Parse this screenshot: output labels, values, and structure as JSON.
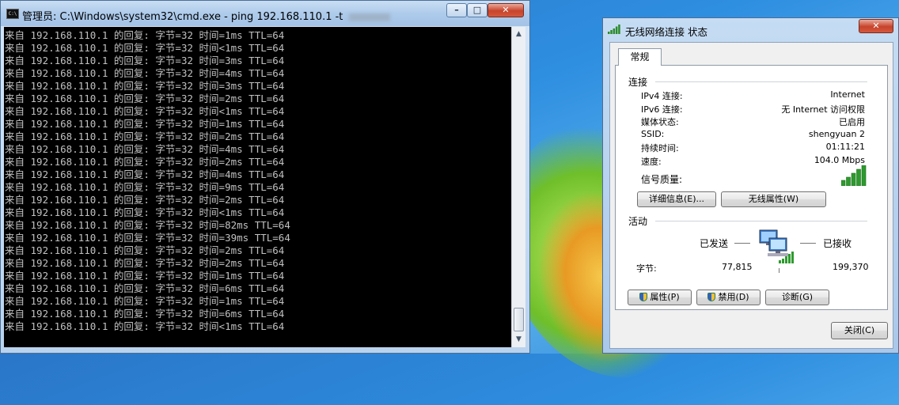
{
  "cmd": {
    "title": "管理员: C:\\Windows\\system32\\cmd.exe - ping  192.168.110.1 -t",
    "icon_text": "C:\\",
    "buttons": {
      "minimize": "–",
      "maximize": "□",
      "close": "✕"
    },
    "lines": [
      "来自 192.168.110.1 的回复: 字节=32 时间=1ms TTL=64",
      "来自 192.168.110.1 的回复: 字节=32 时间<1ms TTL=64",
      "来自 192.168.110.1 的回复: 字节=32 时间=3ms TTL=64",
      "来自 192.168.110.1 的回复: 字节=32 时间=4ms TTL=64",
      "来自 192.168.110.1 的回复: 字节=32 时间=3ms TTL=64",
      "来自 192.168.110.1 的回复: 字节=32 时间=2ms TTL=64",
      "来自 192.168.110.1 的回复: 字节=32 时间<1ms TTL=64",
      "来自 192.168.110.1 的回复: 字节=32 时间=1ms TTL=64",
      "来自 192.168.110.1 的回复: 字节=32 时间=2ms TTL=64",
      "来自 192.168.110.1 的回复: 字节=32 时间=4ms TTL=64",
      "来自 192.168.110.1 的回复: 字节=32 时间=2ms TTL=64",
      "来自 192.168.110.1 的回复: 字节=32 时间=4ms TTL=64",
      "来自 192.168.110.1 的回复: 字节=32 时间=9ms TTL=64",
      "来自 192.168.110.1 的回复: 字节=32 时间=2ms TTL=64",
      "来自 192.168.110.1 的回复: 字节=32 时间<1ms TTL=64",
      "来自 192.168.110.1 的回复: 字节=32 时间=82ms TTL=64",
      "来自 192.168.110.1 的回复: 字节=32 时间=39ms TTL=64",
      "来自 192.168.110.1 的回复: 字节=32 时间=2ms TTL=64",
      "来自 192.168.110.1 的回复: 字节=32 时间=2ms TTL=64",
      "来自 192.168.110.1 的回复: 字节=32 时间=1ms TTL=64",
      "来自 192.168.110.1 的回复: 字节=32 时间=6ms TTL=64",
      "来自 192.168.110.1 的回复: 字节=32 时间=1ms TTL=64",
      "来自 192.168.110.1 的回复: 字节=32 时间=6ms TTL=64",
      "来自 192.168.110.1 的回复: 字节=32 时间<1ms TTL=64"
    ]
  },
  "dialog": {
    "title": "无线网络连接 状态",
    "close_glyph": "✕",
    "tab": "常规",
    "connection": {
      "heading": "连接",
      "rows": [
        {
          "label": "IPv4 连接:",
          "value": "Internet"
        },
        {
          "label": "IPv6 连接:",
          "value": "无 Internet 访问权限"
        },
        {
          "label": "媒体状态:",
          "value": "已启用"
        },
        {
          "label": "SSID:",
          "value": "shengyuan 2"
        },
        {
          "label": "持续时间:",
          "value": "01:11:21"
        },
        {
          "label": "速度:",
          "value": "104.0 Mbps"
        }
      ],
      "signal_label": "信号质量:",
      "signal_bars": 5
    },
    "buttons": {
      "details": "详细信息(E)...",
      "wireless_props": "无线属性(W)",
      "properties": "属性(P)",
      "disable": "禁用(D)",
      "diagnose": "诊断(G)",
      "close": "关闭(C)"
    },
    "activity": {
      "heading": "活动",
      "sent_label": "已发送",
      "received_label": "已接收",
      "bytes_label": "字节:",
      "bytes_sent": "77,815",
      "bytes_received": "199,370"
    }
  },
  "icons": [
    "cmd-icon",
    "wifi-signal-icon",
    "network-computers-icon",
    "uac-shield-icon",
    "scroll-up-icon",
    "scroll-down-icon"
  ]
}
